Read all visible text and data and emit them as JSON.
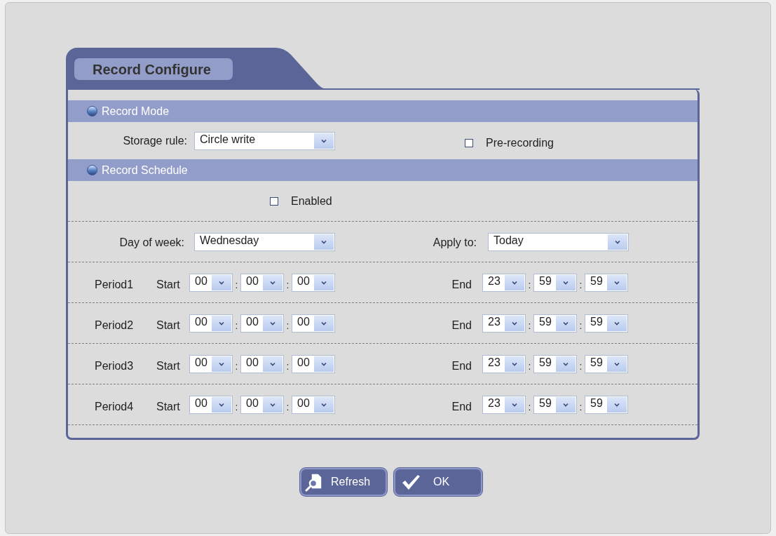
{
  "tab": {
    "title": "Record Configure"
  },
  "record_mode": {
    "title": "Record Mode",
    "storage_rule": {
      "label": "Storage rule:",
      "value": "Circle write"
    },
    "pre_recording": {
      "label": "Pre-recording",
      "checked": false
    }
  },
  "record_schedule": {
    "title": "Record Schedule",
    "enabled": {
      "label": "Enabled",
      "checked": false
    },
    "day_of_week": {
      "label": "Day of week:",
      "value": "Wednesday"
    },
    "apply_to": {
      "label": "Apply to:",
      "value": "Today"
    },
    "periods": [
      {
        "name": "Period1",
        "start": {
          "label": "Start",
          "values": [
            "00",
            "00",
            "00"
          ],
          "separators": [
            ":",
            ":"
          ]
        },
        "end": {
          "label": "End",
          "values": [
            "23",
            "59",
            "59"
          ],
          "separators": [
            ":",
            ":"
          ]
        }
      },
      {
        "name": "Period2",
        "start": {
          "label": "Start",
          "values": [
            "00",
            "00",
            "00"
          ],
          "separators": [
            ":",
            ":"
          ]
        },
        "end": {
          "label": "End",
          "values": [
            "23",
            "59",
            "59"
          ],
          "separators": [
            ":",
            ":"
          ]
        }
      },
      {
        "name": "Period3",
        "start": {
          "label": "Start",
          "values": [
            "00",
            "00",
            "00"
          ],
          "separators": [
            ":",
            ":"
          ]
        },
        "end": {
          "label": "End",
          "values": [
            "23",
            "59",
            "59"
          ],
          "separators": [
            ":",
            ":"
          ]
        }
      },
      {
        "name": "Period4",
        "start": {
          "label": "Start",
          "values": [
            "00",
            "00",
            "00"
          ],
          "separators": [
            ":",
            ":"
          ]
        },
        "end": {
          "label": "End",
          "values": [
            "23",
            "59",
            "59"
          ],
          "separators": [
            ":",
            ":"
          ]
        }
      }
    ]
  },
  "buttons": [
    {
      "kind": "refresh",
      "label": "Refresh"
    },
    {
      "kind": "ok",
      "label": "OK"
    }
  ]
}
